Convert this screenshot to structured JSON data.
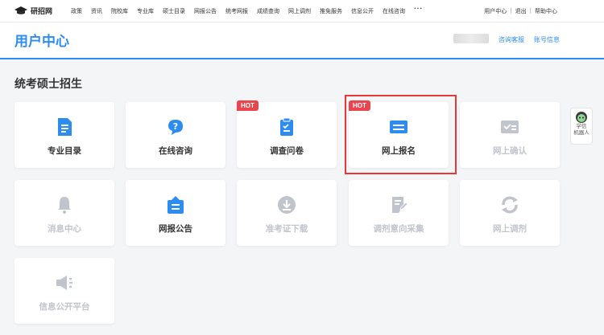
{
  "topnav": {
    "logo_text": "研招网",
    "items": [
      "政策",
      "资讯",
      "院校库",
      "专业库",
      "硕士目录",
      "网报公告",
      "统考网报",
      "成绩查询",
      "网上调剂",
      "推免服务",
      "信息公开",
      "在线咨询"
    ],
    "more": "···",
    "user_links": [
      "用户中心",
      "退出",
      "帮助中心"
    ]
  },
  "header": {
    "title": "用户中心",
    "links": [
      "咨询客服",
      "账号信息"
    ]
  },
  "section": {
    "title": "统考硕士招生"
  },
  "hot_badge": "HOT",
  "cards": [
    {
      "label": "专业目录",
      "icon": "document-icon",
      "enabled": true,
      "hot": false
    },
    {
      "label": "在线咨询",
      "icon": "question-chat-icon",
      "enabled": true,
      "hot": false
    },
    {
      "label": "调查问卷",
      "icon": "clipboard-check-icon",
      "enabled": true,
      "hot": true
    },
    {
      "label": "网上报名",
      "icon": "id-card-icon",
      "enabled": true,
      "hot": true
    },
    {
      "label": "网上确认",
      "icon": "card-check-icon",
      "enabled": false,
      "hot": false
    },
    {
      "label": "消息中心",
      "icon": "bell-icon",
      "enabled": false,
      "hot": false
    },
    {
      "label": "网报公告",
      "icon": "notice-icon",
      "enabled": true,
      "hot": false
    },
    {
      "label": "准考证下载",
      "icon": "download-icon",
      "enabled": false,
      "hot": false
    },
    {
      "label": "调剂意向采集",
      "icon": "form-edit-icon",
      "enabled": false,
      "hot": false
    },
    {
      "label": "网上调剂",
      "icon": "refresh-icon",
      "enabled": false,
      "hot": false
    },
    {
      "label": "信息公开平台",
      "icon": "megaphone-icon",
      "enabled": false,
      "hot": false
    }
  ],
  "robot": {
    "line1": "学信",
    "line2": "机器人"
  },
  "colors": {
    "primary": "#2d8cf0",
    "disabled": "#c0c4cc",
    "hot": "#e8454e",
    "highlight": "#e53935"
  }
}
